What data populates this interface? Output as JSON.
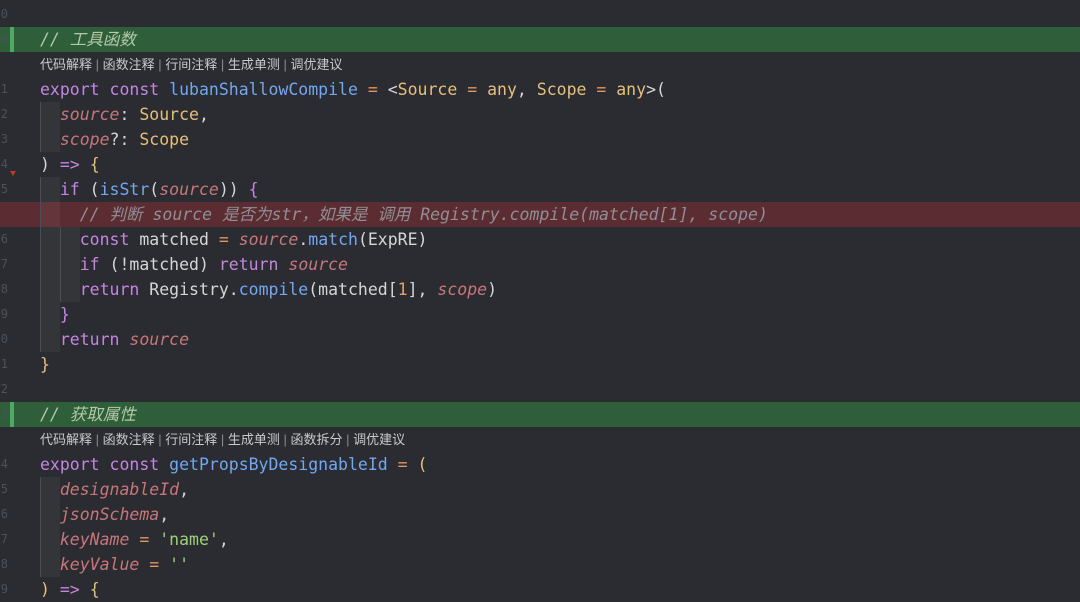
{
  "editor": {
    "line_numbers": [
      "0",
      "0",
      "",
      "1",
      "2",
      "3",
      "4",
      "5",
      "",
      "6",
      "7",
      "8",
      "9",
      "0",
      "1",
      "2",
      "3",
      "",
      "4",
      "5",
      "6",
      "7",
      "8",
      "9"
    ],
    "code_lens_1": [
      "代码解释",
      "函数注释",
      "行间注释",
      "生成单测",
      "调优建议"
    ],
    "code_lens_2": [
      "代码解释",
      "函数注释",
      "行间注释",
      "生成单测",
      "函数拆分",
      "调优建议"
    ],
    "lines": [
      {
        "tokens": []
      },
      {
        "tokens": [
          {
            "c": "cmg",
            "t": "// 工具函数"
          }
        ]
      },
      {
        "tokens": []
      },
      {
        "tokens": [
          {
            "c": "kw",
            "t": "export "
          },
          {
            "c": "kw",
            "t": "const "
          },
          {
            "c": "fn",
            "t": "lubanShallowCompile"
          },
          {
            "c": "op",
            "t": " = "
          },
          {
            "c": "pl",
            "t": "<"
          },
          {
            "c": "type",
            "t": "Source"
          },
          {
            "c": "op",
            "t": " = "
          },
          {
            "c": "type",
            "t": "any"
          },
          {
            "c": "pl",
            "t": ", "
          },
          {
            "c": "type",
            "t": "Scope"
          },
          {
            "c": "op",
            "t": " = "
          },
          {
            "c": "type",
            "t": "any"
          },
          {
            "c": "pl",
            "t": ">("
          }
        ]
      },
      {
        "tokens": [
          {
            "c": "pl",
            "t": "  "
          },
          {
            "c": "par",
            "t": "source"
          },
          {
            "c": "pl",
            "t": ": "
          },
          {
            "c": "type",
            "t": "Source"
          },
          {
            "c": "pl",
            "t": ","
          }
        ]
      },
      {
        "tokens": [
          {
            "c": "pl",
            "t": "  "
          },
          {
            "c": "par",
            "t": "scope"
          },
          {
            "c": "pl",
            "t": "?: "
          },
          {
            "c": "type",
            "t": "Scope"
          }
        ]
      },
      {
        "tokens": [
          {
            "c": "pl",
            "t": ") "
          },
          {
            "c": "kw",
            "t": "=>"
          },
          {
            "c": "pl",
            "t": " "
          },
          {
            "c": "brk",
            "t": "{"
          }
        ]
      },
      {
        "tokens": [
          {
            "c": "pl",
            "t": "  "
          },
          {
            "c": "kw",
            "t": "if"
          },
          {
            "c": "pl",
            "t": " ("
          },
          {
            "c": "fn",
            "t": "isStr"
          },
          {
            "c": "pl",
            "t": "("
          },
          {
            "c": "par",
            "t": "source"
          },
          {
            "c": "pl",
            "t": ")) "
          },
          {
            "c": "kw",
            "t": "{"
          }
        ]
      },
      {
        "tokens": [
          {
            "c": "pl",
            "t": "    "
          },
          {
            "c": "cm",
            "t": "// 判断 source 是否为str，如果是 调用 Registry.compile(matched[1], scope)"
          }
        ]
      },
      {
        "tokens": [
          {
            "c": "pl",
            "t": "    "
          },
          {
            "c": "kw",
            "t": "const "
          },
          {
            "c": "pl",
            "t": "matched"
          },
          {
            "c": "op",
            "t": " = "
          },
          {
            "c": "par",
            "t": "source"
          },
          {
            "c": "pl",
            "t": "."
          },
          {
            "c": "fn",
            "t": "match"
          },
          {
            "c": "pl",
            "t": "(ExpRE)"
          }
        ]
      },
      {
        "tokens": [
          {
            "c": "pl",
            "t": "    "
          },
          {
            "c": "kw",
            "t": "if"
          },
          {
            "c": "pl",
            "t": " (!matched) "
          },
          {
            "c": "kw",
            "t": "return "
          },
          {
            "c": "par",
            "t": "source"
          }
        ]
      },
      {
        "tokens": [
          {
            "c": "pl",
            "t": "    "
          },
          {
            "c": "kw",
            "t": "return "
          },
          {
            "c": "pl",
            "t": "Registry."
          },
          {
            "c": "fn",
            "t": "compile"
          },
          {
            "c": "pl",
            "t": "(matched["
          },
          {
            "c": "num",
            "t": "1"
          },
          {
            "c": "pl",
            "t": "], "
          },
          {
            "c": "par",
            "t": "scope"
          },
          {
            "c": "pl",
            "t": ")"
          }
        ]
      },
      {
        "tokens": [
          {
            "c": "pl",
            "t": "  "
          },
          {
            "c": "kw",
            "t": "}"
          }
        ]
      },
      {
        "tokens": [
          {
            "c": "pl",
            "t": "  "
          },
          {
            "c": "kw",
            "t": "return "
          },
          {
            "c": "par",
            "t": "source"
          }
        ]
      },
      {
        "tokens": [
          {
            "c": "brk",
            "t": "}"
          }
        ]
      },
      {
        "tokens": []
      },
      {
        "tokens": [
          {
            "c": "cmg",
            "t": "// 获取属性"
          }
        ]
      },
      {
        "tokens": []
      },
      {
        "tokens": [
          {
            "c": "kw",
            "t": "export "
          },
          {
            "c": "kw",
            "t": "const "
          },
          {
            "c": "fn",
            "t": "getPropsByDesignableId"
          },
          {
            "c": "op",
            "t": " = "
          },
          {
            "c": "brk",
            "t": "("
          }
        ]
      },
      {
        "tokens": [
          {
            "c": "pl",
            "t": "  "
          },
          {
            "c": "par",
            "t": "designableId"
          },
          {
            "c": "pl",
            "t": ","
          }
        ]
      },
      {
        "tokens": [
          {
            "c": "pl",
            "t": "  "
          },
          {
            "c": "par",
            "t": "jsonSchema"
          },
          {
            "c": "pl",
            "t": ","
          }
        ]
      },
      {
        "tokens": [
          {
            "c": "pl",
            "t": "  "
          },
          {
            "c": "par",
            "t": "keyName"
          },
          {
            "c": "op",
            "t": " = "
          },
          {
            "c": "str",
            "t": "'name'"
          },
          {
            "c": "pl",
            "t": ","
          }
        ]
      },
      {
        "tokens": [
          {
            "c": "pl",
            "t": "  "
          },
          {
            "c": "par",
            "t": "keyValue"
          },
          {
            "c": "op",
            "t": " = "
          },
          {
            "c": "str",
            "t": "''"
          }
        ]
      },
      {
        "tokens": [
          {
            "c": "brk",
            "t": ")"
          },
          {
            "c": "pl",
            "t": " "
          },
          {
            "c": "kw",
            "t": "=>"
          },
          {
            "c": "pl",
            "t": " "
          },
          {
            "c": "brk",
            "t": "{"
          }
        ]
      }
    ]
  }
}
